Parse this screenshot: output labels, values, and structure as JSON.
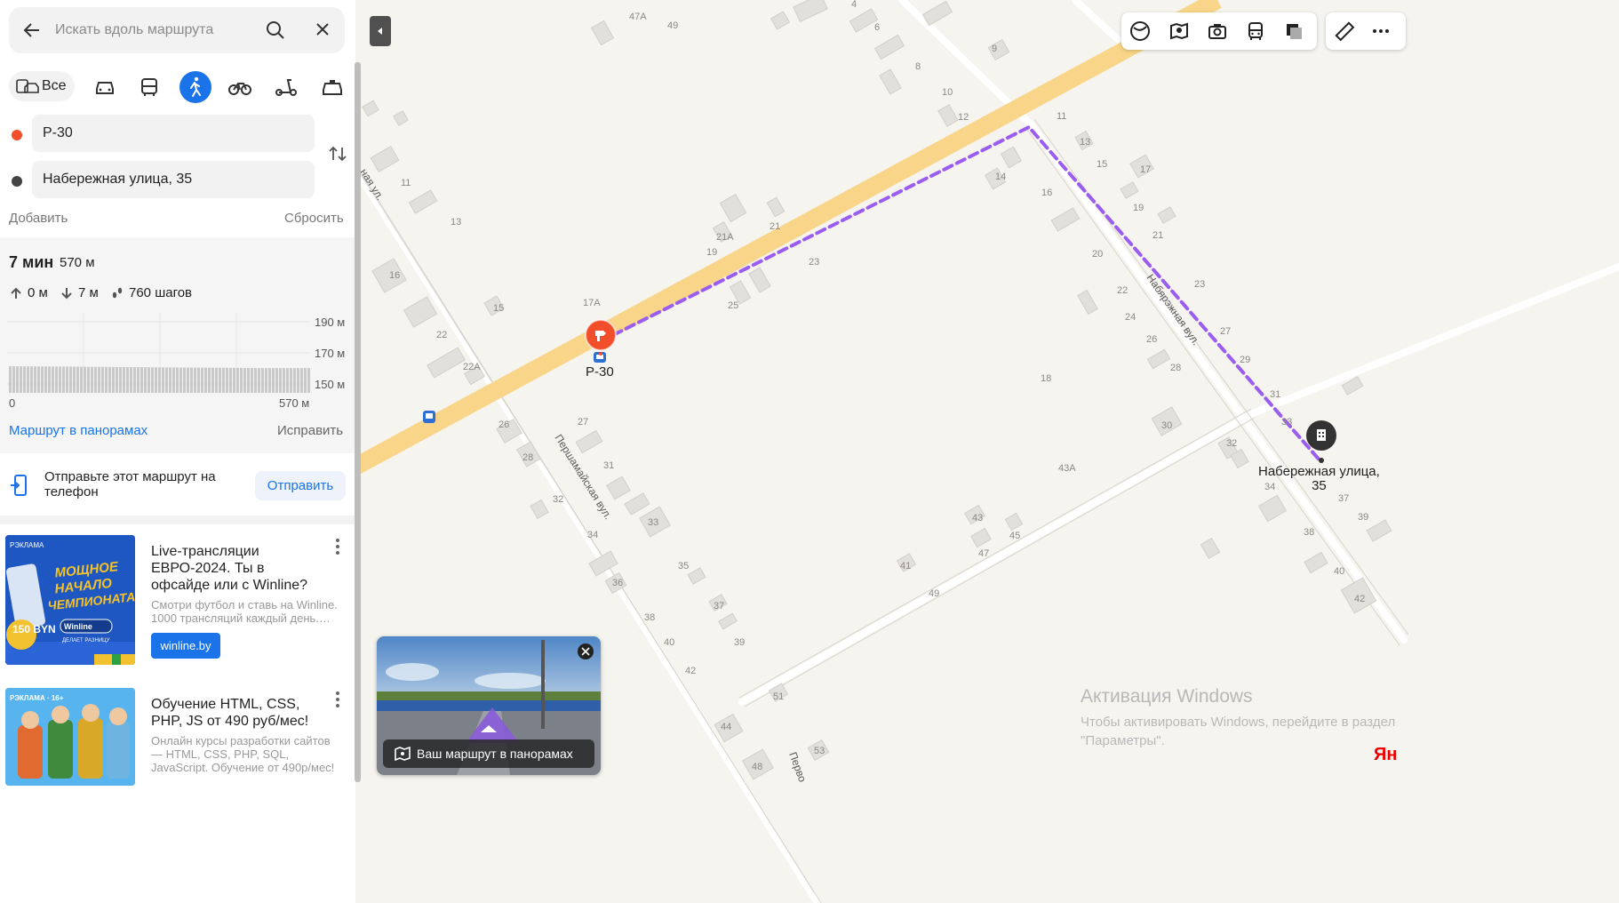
{
  "search": {
    "placeholder": "Искать вдоль маршрута"
  },
  "modes": {
    "all_label": "Все",
    "active": "pedestrian"
  },
  "route": {
    "from": "Р-30",
    "to": "Набережная улица, 35",
    "add_label": "Добавить",
    "reset_label": "Сбросить"
  },
  "summary": {
    "time": "7 мин",
    "distance": "570 м",
    "ascent": "0 м",
    "descent": "7 м",
    "steps": "760 шагов"
  },
  "elevation": {
    "y_labels": [
      "190 м",
      "170 м",
      "150 м"
    ],
    "x_start": "0",
    "x_end": "570 м"
  },
  "links": {
    "panorama": "Маршрут в панорамах",
    "fix": "Исправить"
  },
  "send": {
    "text": "Отправьте этот маршрут на телефон",
    "button": "Отправить"
  },
  "ads": [
    {
      "badge": "РЭКЛАМА",
      "title": "Live-трансляции ЕВРО-2024. Ты в офсайде или с Winline?",
      "desc": "Смотри футбол и ставь на Winline. 1000 трансляций каждый день.…",
      "button": "winline.by",
      "img_text": "МОЩНОЕ НАЧАЛО ЧЕМПИОНАТА",
      "img_brand": "Winline",
      "img_sub": "ДЕЛАЕТ РАЗНИЦУ",
      "img_amount": "150 BYN"
    },
    {
      "badge": "РЭКЛАМА · 16+",
      "title": "Обучение HTML, CSS, PHP, JS от 490 руб/мес!",
      "desc": "Онлайн курсы разработки сайтов — HTML, CSS, PHP, SQL, JavaScript. Обучение от 490р/мес!"
    }
  ],
  "panorama_preview": {
    "label": "Ваш маршрут в панорамах"
  },
  "map": {
    "start_label": "Р-30",
    "end_label": "Набережная улица,\n35",
    "streets": [
      "Набярэжная вул.",
      "Першамайская вул.",
      "ная ул.",
      "Перво"
    ],
    "house_numbers": [
      "47А",
      "49",
      "4",
      "6",
      "9",
      "8",
      "10",
      "12",
      "11",
      "13",
      "15",
      "17",
      "19",
      "21",
      "21А",
      "21",
      "14",
      "16",
      "19",
      "20",
      "22",
      "23",
      "24",
      "26",
      "27",
      "28",
      "29",
      "23",
      "25",
      "17А",
      "11",
      "13",
      "16",
      "15",
      "22",
      "22А",
      "26",
      "27",
      "28",
      "31",
      "32",
      "33",
      "34",
      "35",
      "36",
      "37",
      "38",
      "39",
      "40",
      "42",
      "41",
      "43",
      "43А",
      "45",
      "47",
      "49",
      "51",
      "44",
      "48",
      "53",
      "30",
      "31",
      "32",
      "33",
      "34",
      "37",
      "38",
      "39",
      "40",
      "42",
      "18"
    ]
  },
  "watermark": {
    "title": "Активация Windows",
    "text": "Чтобы активировать Windows, перейдите в раздел \"Параметры\".",
    "logo": "Ян"
  },
  "colors": {
    "accent": "#1a73e8",
    "route": "#9b5cf0",
    "road": "#f8d588",
    "start": "#f24e2b"
  }
}
